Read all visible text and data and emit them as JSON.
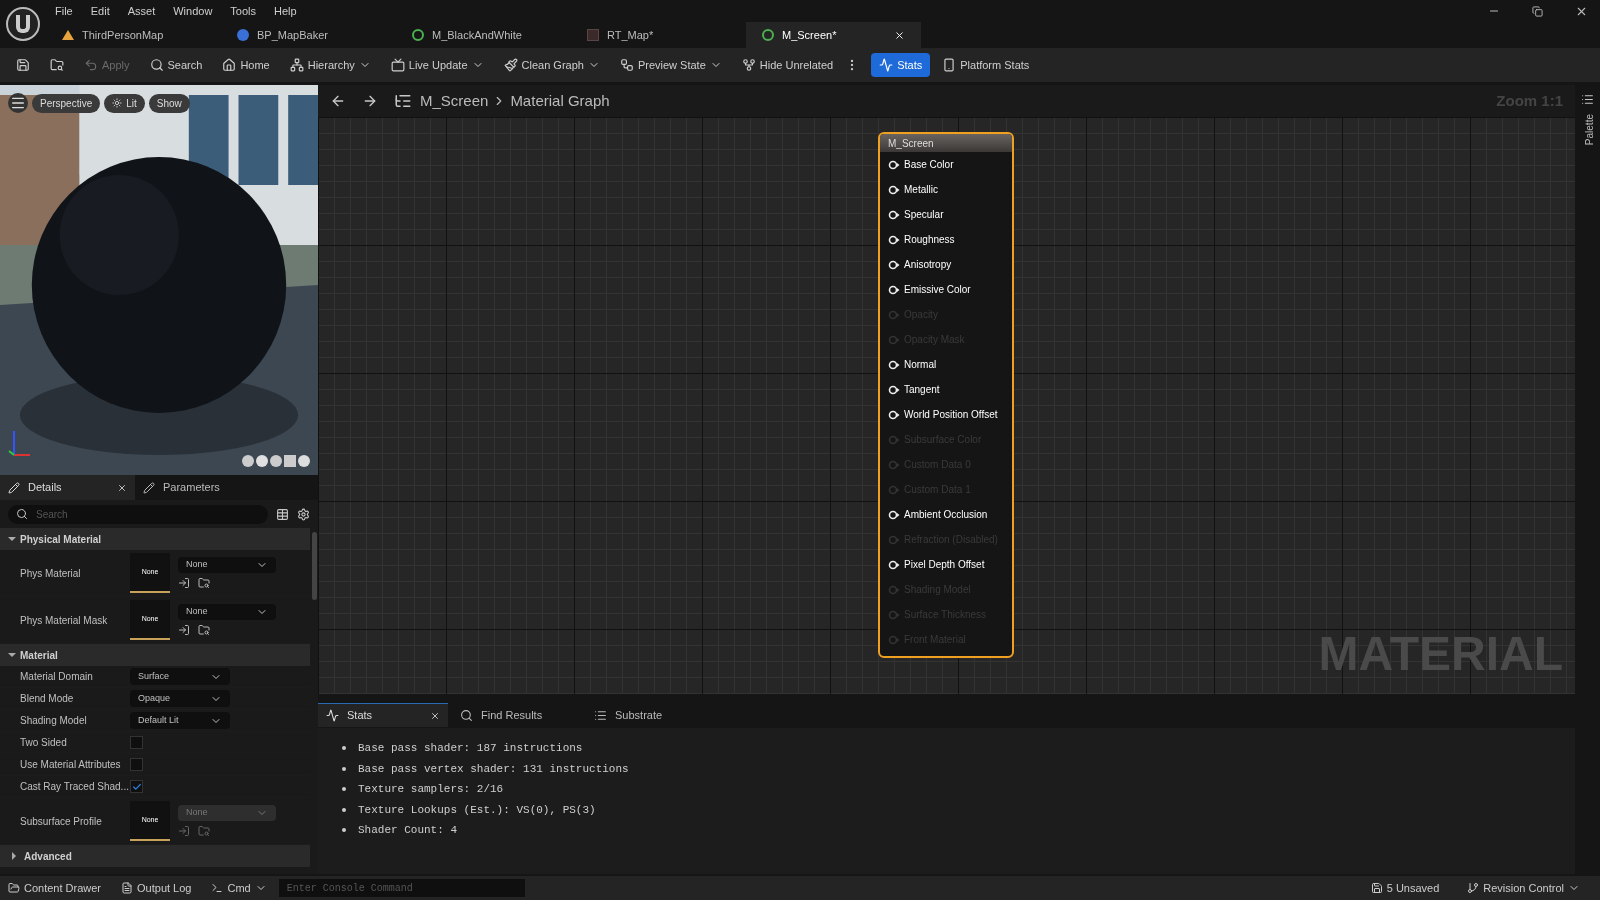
{
  "menu": [
    "File",
    "Edit",
    "Asset",
    "Window",
    "Tools",
    "Help"
  ],
  "tabs": [
    {
      "label": "ThirdPersonMap",
      "kind": "map",
      "selected": false
    },
    {
      "label": "BP_MapBaker",
      "kind": "blueprint",
      "selected": false
    },
    {
      "label": "M_BlackAndWhite",
      "kind": "material",
      "selected": false
    },
    {
      "label": "RT_Map*",
      "kind": "texture",
      "selected": false
    },
    {
      "label": "M_Screen*",
      "kind": "material",
      "selected": true
    }
  ],
  "toolbar": [
    {
      "kind": "save",
      "disabled": false,
      "selected": false,
      "dropdown": false
    },
    {
      "kind": "browse",
      "disabled": false,
      "selected": false,
      "dropdown": false
    },
    {
      "kind": "apply",
      "label": "Apply",
      "disabled": true,
      "selected": false,
      "dropdown": false
    },
    {
      "kind": "search",
      "label": "Search",
      "disabled": false,
      "selected": false,
      "dropdown": false
    },
    {
      "kind": "home",
      "label": "Home",
      "disabled": false,
      "selected": false,
      "dropdown": false
    },
    {
      "kind": "hierarchy",
      "label": "Hierarchy",
      "disabled": false,
      "selected": false,
      "dropdown": true
    },
    {
      "kind": "live-update",
      "label": "Live Update",
      "disabled": false,
      "selected": false,
      "dropdown": true
    },
    {
      "kind": "clean-graph",
      "label": "Clean Graph",
      "disabled": false,
      "selected": false,
      "dropdown": true
    },
    {
      "kind": "preview-state",
      "label": "Preview State",
      "disabled": false,
      "selected": false,
      "dropdown": true
    },
    {
      "kind": "hide-unrelated",
      "label": "Hide Unrelated",
      "disabled": false,
      "selected": false,
      "dropdown": false
    },
    {
      "kind": "stats",
      "label": "Stats",
      "disabled": false,
      "selected": true,
      "dropdown": false
    },
    {
      "kind": "platform-stats",
      "label": "Platform Stats",
      "disabled": false,
      "selected": false,
      "dropdown": false
    }
  ],
  "viewport": {
    "buttons": [
      {
        "kind": "perspective",
        "label": "Perspective"
      },
      {
        "kind": "lit",
        "label": "Lit"
      },
      {
        "kind": "show",
        "label": "Show"
      }
    ]
  },
  "details": {
    "tabs": [
      {
        "label": "Details",
        "selected": true
      },
      {
        "label": "Parameters",
        "selected": false
      }
    ],
    "search": {
      "placeholder": "Search"
    },
    "sections": [
      {
        "title": "Physical Material",
        "expanded": true,
        "rows": [
          {
            "kind": "asset",
            "label": "Phys Material",
            "thumb": "None",
            "value": "None",
            "disabled": false
          },
          {
            "kind": "asset",
            "label": "Phys Material Mask",
            "thumb": "None",
            "value": "None",
            "disabled": false
          }
        ]
      },
      {
        "title": "Material",
        "expanded": true,
        "rows": [
          {
            "kind": "dropdown",
            "label": "Material Domain",
            "value": "Surface"
          },
          {
            "kind": "dropdown",
            "label": "Blend Mode",
            "value": "Opaque"
          },
          {
            "kind": "dropdown",
            "label": "Shading Model",
            "value": "Default Lit"
          },
          {
            "kind": "checkbox",
            "label": "Two Sided",
            "checked": false
          },
          {
            "kind": "checkbox",
            "label": "Use Material Attributes",
            "checked": false
          },
          {
            "kind": "checkbox",
            "label": "Cast Ray Traced Shad...",
            "checked": true
          },
          {
            "kind": "asset",
            "label": "Subsurface Profile",
            "thumb": "None",
            "value": "None",
            "disabled": true
          }
        ]
      },
      {
        "title": "Advanced",
        "expanded": false
      }
    ]
  },
  "graph": {
    "breadcrumb": [
      "M_Screen",
      "Material Graph"
    ],
    "zoom": "Zoom 1:1",
    "watermark": "MATERIAL",
    "palette": "Palette",
    "node": {
      "title": "M_Screen",
      "pins": [
        {
          "label": "Base Color",
          "enabled": true
        },
        {
          "label": "Metallic",
          "enabled": true
        },
        {
          "label": "Specular",
          "enabled": true
        },
        {
          "label": "Roughness",
          "enabled": true
        },
        {
          "label": "Anisotropy",
          "enabled": true
        },
        {
          "label": "Emissive Color",
          "enabled": true
        },
        {
          "label": "Opacity",
          "enabled": false
        },
        {
          "label": "Opacity Mask",
          "enabled": false
        },
        {
          "label": "Normal",
          "enabled": true
        },
        {
          "label": "Tangent",
          "enabled": true
        },
        {
          "label": "World Position Offset",
          "enabled": true
        },
        {
          "label": "Subsurface Color",
          "enabled": false
        },
        {
          "label": "Custom Data 0",
          "enabled": false
        },
        {
          "label": "Custom Data 1",
          "enabled": false
        },
        {
          "label": "Ambient Occlusion",
          "enabled": true
        },
        {
          "label": "Refraction (Disabled)",
          "enabled": false
        },
        {
          "label": "Pixel Depth Offset",
          "enabled": true
        },
        {
          "label": "Shading Model",
          "enabled": false
        },
        {
          "label": "Surface Thickness",
          "enabled": false
        },
        {
          "label": "Front Material",
          "enabled": false
        }
      ]
    }
  },
  "stats_panel": {
    "tabs": [
      {
        "kind": "stats",
        "label": "Stats",
        "selected": true
      },
      {
        "kind": "find",
        "label": "Find Results",
        "selected": false
      },
      {
        "kind": "substrate",
        "label": "Substrate",
        "selected": false
      }
    ],
    "lines": [
      "Base pass shader: 187 instructions",
      "Base pass vertex shader: 131 instructions",
      "Texture samplers: 2/16",
      "Texture Lookups (Est.): VS(0), PS(3)",
      "Shader Count: 4"
    ]
  },
  "status_bar": {
    "content_drawer": "Content Drawer",
    "output_log": "Output Log",
    "cmd": "Cmd",
    "console": {
      "placeholder": "Enter Console Command"
    },
    "unsaved": "5 Unsaved",
    "revision": "Revision Control"
  }
}
